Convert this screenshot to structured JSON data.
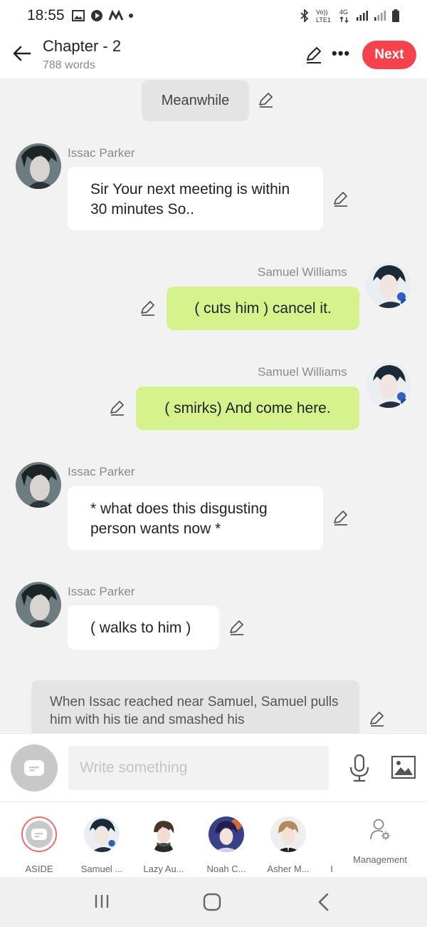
{
  "status_bar": {
    "time": "18:55",
    "network_label_top": "Vo))",
    "network_label_bottom": "LTE1",
    "network_type": "4G"
  },
  "header": {
    "title": "Chapter - 2",
    "word_count": "788 words",
    "next_label": "Next",
    "more_label": "•••"
  },
  "chat": {
    "scene_label": "Meanwhile",
    "messages": [
      {
        "sender": "Issac Parker",
        "text": "Sir Your next meeting is within 30 minutes So..",
        "side": "left"
      },
      {
        "sender": "Samuel Williams",
        "text": "( cuts him ) cancel it.",
        "side": "right"
      },
      {
        "sender": "Samuel Williams",
        "text": "( smirks) And come here.",
        "side": "right"
      },
      {
        "sender": "Issac Parker",
        "text": "* what does this disgusting person wants now *",
        "side": "left"
      },
      {
        "sender": "Issac Parker",
        "text": "( walks to him )",
        "side": "left"
      }
    ],
    "narration": "When Issac reached near Samuel, Samuel pulls him with his tie and smashed his"
  },
  "compose": {
    "placeholder": "Write something"
  },
  "characters": [
    {
      "label": "ASIDE"
    },
    {
      "label": "Samuel ..."
    },
    {
      "label": "Lazy Au..."
    },
    {
      "label": "Noah C..."
    },
    {
      "label": "Asher M..."
    },
    {
      "label": "I"
    }
  ],
  "management_label": "Management",
  "colors": {
    "accent": "#f6424c",
    "green_bubble": "#d5f28c",
    "background": "#f2f2f2"
  }
}
